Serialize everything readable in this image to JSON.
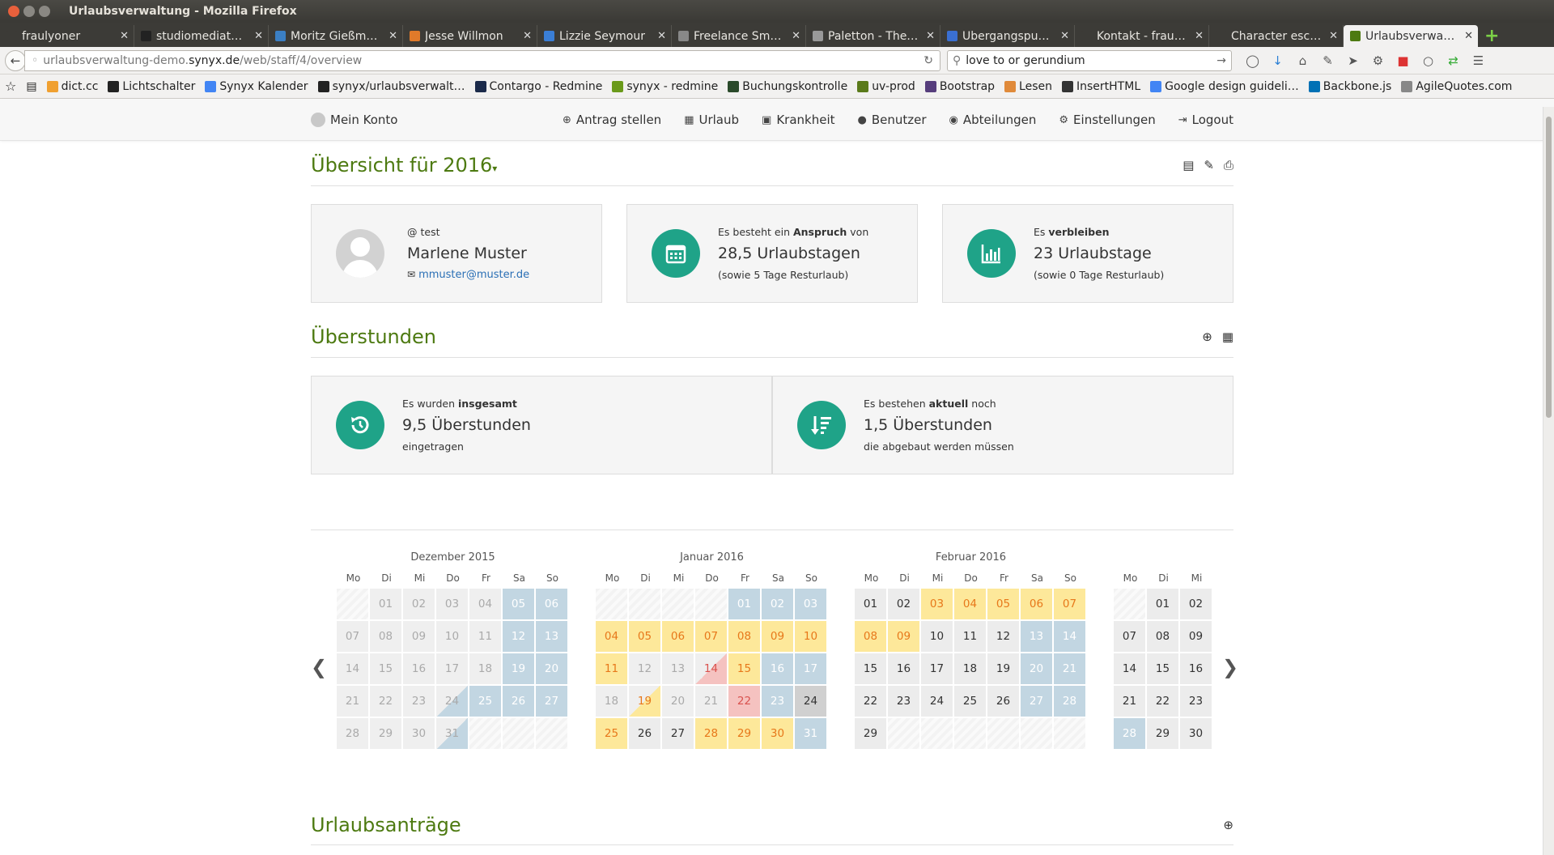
{
  "window": {
    "title": "Urlaubsverwaltung - Mozilla Firefox"
  },
  "tabs": [
    {
      "label": "fraulyoner",
      "color": "#3c3b37"
    },
    {
      "label": "studiomediat…",
      "color": "#222"
    },
    {
      "label": "Moritz Gießm…",
      "color": "#3b7fc4"
    },
    {
      "label": "Jesse Willmon",
      "color": "#e07a2a"
    },
    {
      "label": "Lizzie Seymour",
      "color": "#3a7ed6"
    },
    {
      "label": "Freelance Sm…",
      "color": "#888"
    },
    {
      "label": "Paletton - The…",
      "color": "#999"
    },
    {
      "label": "Übergangspu…",
      "color": "#3a6fd1"
    },
    {
      "label": "Kontakt - frauho…",
      "color": "#3c3b37"
    },
    {
      "label": "Character escap…",
      "color": "#3c3b37"
    },
    {
      "label": "Urlaubsverwa…",
      "color": "#4d7a11"
    }
  ],
  "nav": {
    "url_prefix": "urlaubsverwaltung-demo.",
    "url_host": "synyx.de",
    "url_path": "/web/staff/4/overview",
    "search_value": "love to or gerundium"
  },
  "bookmarks": [
    {
      "label": "dict.cc",
      "color": "#f0a030"
    },
    {
      "label": "Lichtschalter",
      "color": "#222"
    },
    {
      "label": "Synyx Kalender",
      "color": "#4285f4"
    },
    {
      "label": "synyx/urlaubsverwalt…",
      "color": "#222"
    },
    {
      "label": "Contargo - Redmine",
      "color": "#1b2a4a"
    },
    {
      "label": "synyx - redmine",
      "color": "#6a9a1a"
    },
    {
      "label": "Buchungskontrolle",
      "color": "#2a4a2a"
    },
    {
      "label": "uv-prod",
      "color": "#5a7a1a"
    },
    {
      "label": "Bootstrap",
      "color": "#563d7c"
    },
    {
      "label": "Lesen",
      "color": "#e08a3a"
    },
    {
      "label": "InsertHTML",
      "color": "#333"
    },
    {
      "label": "Google design guideli…",
      "color": "#4285f4"
    },
    {
      "label": "Backbone.js",
      "color": "#0071b5"
    },
    {
      "label": "AgileQuotes.com",
      "color": "#888"
    }
  ],
  "appnav": {
    "account": "Mein Konto",
    "items": [
      {
        "label": "Antrag stellen",
        "icon": "plus-circle-icon"
      },
      {
        "label": "Urlaub",
        "icon": "calendar-icon"
      },
      {
        "label": "Krankheit",
        "icon": "medkit-icon"
      },
      {
        "label": "Benutzer",
        "icon": "user-icon"
      },
      {
        "label": "Abteilungen",
        "icon": "group-icon"
      },
      {
        "label": "Einstellungen",
        "icon": "gear-icon"
      },
      {
        "label": "Logout",
        "icon": "logout-icon"
      }
    ]
  },
  "overview": {
    "title": "Übersicht für 2016",
    "user": {
      "handle": "@ test",
      "name": "Marlene Muster",
      "email": "mmuster@muster.de"
    },
    "entitlement": {
      "prefix": "Es besteht ein ",
      "bold": "Anspruch",
      "suffix": " von",
      "value": "28,5 Urlaubstagen",
      "note": "(sowie 5 Tage Resturlaub)"
    },
    "remaining": {
      "prefix": "Es ",
      "bold": "verbleiben",
      "value": "23 Urlaubstage",
      "note": "(sowie 0 Tage Resturlaub)"
    }
  },
  "overtime": {
    "title": "Überstunden",
    "total": {
      "prefix": "Es wurden ",
      "bold": "insgesamt",
      "value": "9,5 Überstunden",
      "note": "eingetragen"
    },
    "current": {
      "prefix": "Es bestehen ",
      "bold": "aktuell",
      "suffix": " noch",
      "value": "1,5 Überstunden",
      "note": "die abgebaut werden müssen"
    }
  },
  "calendar": {
    "weekdays": [
      "Mo",
      "Di",
      "Mi",
      "Do",
      "Fr",
      "Sa",
      "So"
    ],
    "months": [
      {
        "title": "Dezember 2015",
        "offset": 1,
        "days": [
          [
            "01",
            "gl"
          ],
          [
            "02",
            "gl"
          ],
          [
            "03",
            "gl"
          ],
          [
            "04",
            "gl"
          ],
          [
            "05",
            "w"
          ],
          [
            "06",
            "w"
          ],
          [
            "07",
            "gl"
          ],
          [
            "08",
            "gl"
          ],
          [
            "09",
            "gl"
          ],
          [
            "10",
            "gl"
          ],
          [
            "11",
            "gl"
          ],
          [
            "12",
            "w"
          ],
          [
            "13",
            "w"
          ],
          [
            "14",
            "gl"
          ],
          [
            "15",
            "gl"
          ],
          [
            "16",
            "gl"
          ],
          [
            "17",
            "gl"
          ],
          [
            "18",
            "gl"
          ],
          [
            "19",
            "w"
          ],
          [
            "20",
            "w"
          ],
          [
            "21",
            "gl"
          ],
          [
            "22",
            "gl"
          ],
          [
            "23",
            "gl"
          ],
          [
            "24",
            "hw"
          ],
          [
            "25",
            "w"
          ],
          [
            "26",
            "w"
          ],
          [
            "27",
            "w"
          ],
          [
            "28",
            "gl"
          ],
          [
            "29",
            "gl"
          ],
          [
            "30",
            "gl"
          ],
          [
            "31",
            "hw"
          ]
        ]
      },
      {
        "title": "Januar 2016",
        "offset": 4,
        "days": [
          [
            "01",
            "w"
          ],
          [
            "02",
            "w"
          ],
          [
            "03",
            "w"
          ],
          [
            "04",
            "y"
          ],
          [
            "05",
            "y"
          ],
          [
            "06",
            "y"
          ],
          [
            "07",
            "y"
          ],
          [
            "08",
            "y"
          ],
          [
            "09",
            "y"
          ],
          [
            "10",
            "y"
          ],
          [
            "11",
            "y"
          ],
          [
            "12",
            "gl"
          ],
          [
            "13",
            "gl"
          ],
          [
            "14",
            "hr"
          ],
          [
            "15",
            "y"
          ],
          [
            "16",
            "w"
          ],
          [
            "17",
            "w"
          ],
          [
            "18",
            "gl"
          ],
          [
            "19",
            "hy"
          ],
          [
            "20",
            "gl"
          ],
          [
            "21",
            "gl"
          ],
          [
            "22",
            "r"
          ],
          [
            "23",
            "w"
          ],
          [
            "24",
            "dg"
          ],
          [
            "25",
            "y"
          ],
          [
            "26",
            "g"
          ],
          [
            "27",
            "g"
          ],
          [
            "28",
            "y"
          ],
          [
            "29",
            "y"
          ],
          [
            "30",
            "y"
          ],
          [
            "31",
            "w"
          ]
        ]
      },
      {
        "title": "Februar 2016",
        "offset": 0,
        "days": [
          [
            "01",
            "g"
          ],
          [
            "02",
            "g"
          ],
          [
            "03",
            "y"
          ],
          [
            "04",
            "y"
          ],
          [
            "05",
            "y"
          ],
          [
            "06",
            "y"
          ],
          [
            "07",
            "y"
          ],
          [
            "08",
            "y"
          ],
          [
            "09",
            "y"
          ],
          [
            "10",
            "g"
          ],
          [
            "11",
            "g"
          ],
          [
            "12",
            "g"
          ],
          [
            "13",
            "w"
          ],
          [
            "14",
            "w"
          ],
          [
            "15",
            "g"
          ],
          [
            "16",
            "g"
          ],
          [
            "17",
            "g"
          ],
          [
            "18",
            "g"
          ],
          [
            "19",
            "g"
          ],
          [
            "20",
            "w"
          ],
          [
            "21",
            "w"
          ],
          [
            "22",
            "g"
          ],
          [
            "23",
            "g"
          ],
          [
            "24",
            "g"
          ],
          [
            "25",
            "g"
          ],
          [
            "26",
            "g"
          ],
          [
            "27",
            "w"
          ],
          [
            "28",
            "w"
          ],
          [
            "29",
            "g"
          ]
        ]
      },
      {
        "title": "",
        "offset": 1,
        "days": [
          [
            "01",
            "g"
          ],
          [
            "02",
            "g"
          ],
          [
            "07",
            "g"
          ],
          [
            "08",
            "g"
          ],
          [
            "09",
            "g"
          ],
          [
            "14",
            "g"
          ],
          [
            "15",
            "g"
          ],
          [
            "16",
            "g"
          ],
          [
            "21",
            "g"
          ],
          [
            "22",
            "g"
          ],
          [
            "23",
            "g"
          ],
          [
            "28",
            "w"
          ],
          [
            "29",
            "g"
          ],
          [
            "30",
            "g"
          ]
        ]
      }
    ]
  },
  "requests": {
    "title": "Urlaubsanträge"
  }
}
